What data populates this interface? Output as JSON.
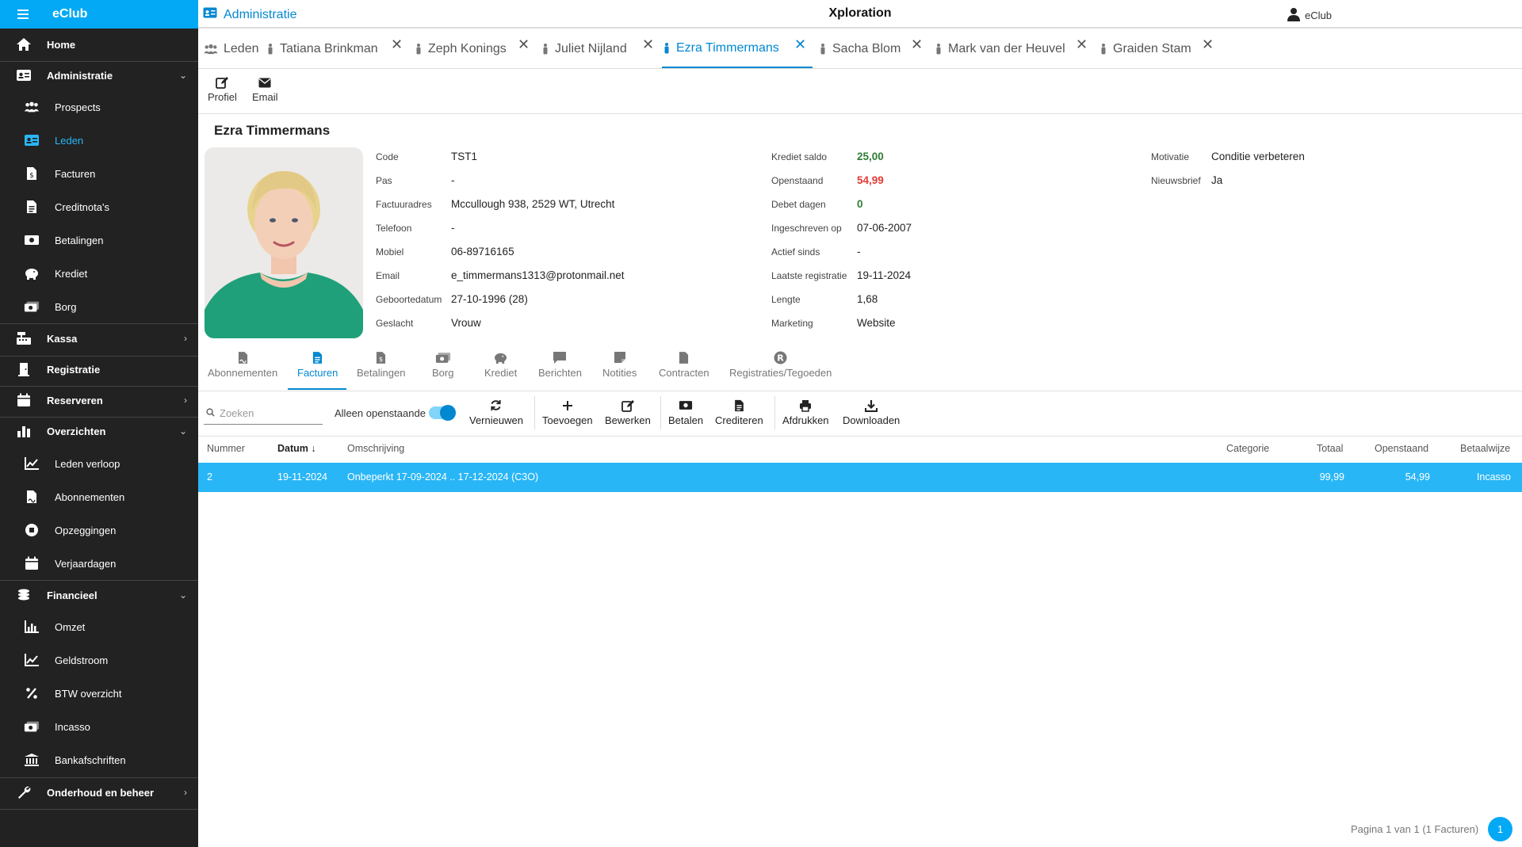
{
  "app": {
    "name": "eClub"
  },
  "topbar": {
    "module": "Administratie",
    "center_title": "Xploration",
    "user": "eClub"
  },
  "sidebar": {
    "home": "Home",
    "administratie": "Administratie",
    "prospects": "Prospects",
    "leden": "Leden",
    "facturen": "Facturen",
    "creditnotas": "Creditnota's",
    "betalingen": "Betalingen",
    "krediet": "Krediet",
    "borg": "Borg",
    "kassa": "Kassa",
    "registratie": "Registratie",
    "reserveren": "Reserveren",
    "overzichten": "Overzichten",
    "leden_verloop": "Leden verloop",
    "abonnementen": "Abonnementen",
    "opzeggingen": "Opzeggingen",
    "verjaardagen": "Verjaardagen",
    "financieel": "Financieel",
    "omzet": "Omzet",
    "geldstroom": "Geldstroom",
    "btw": "BTW overzicht",
    "incasso": "Incasso",
    "bankafschriften": "Bankafschriften",
    "onderhoud": "Onderhoud en beheer"
  },
  "tabs": {
    "leden": "Leden",
    "t1": "Tatiana Brinkman",
    "t2": "Zeph Konings",
    "t3": "Juliet Nijland",
    "t4": "Ezra Timmermans",
    "t5": "Sacha Blom",
    "t6": "Mark van der Heuvel",
    "t7": "Graiden Stam",
    "close": "✕"
  },
  "actions": {
    "profiel": "Profiel",
    "email": "Email"
  },
  "member": {
    "name": "Ezra Timmermans",
    "labels": {
      "code": "Code",
      "pas": "Pas",
      "factuuradres": "Factuuradres",
      "telefoon": "Telefoon",
      "mobiel": "Mobiel",
      "email": "Email",
      "geboortedatum": "Geboortedatum",
      "geslacht": "Geslacht",
      "krediet_saldo": "Krediet saldo",
      "openstaand": "Openstaand",
      "debet_dagen": "Debet dagen",
      "ingeschreven_op": "Ingeschreven op",
      "actief_sinds": "Actief sinds",
      "laatste_registratie": "Laatste registratie",
      "lengte": "Lengte",
      "marketing": "Marketing",
      "motivatie": "Motivatie",
      "nieuwsbrief": "Nieuwsbrief"
    },
    "values": {
      "code": "TST1",
      "pas": "-",
      "factuuradres": "Mccullough 938, 2529 WT, Utrecht",
      "telefoon": "-",
      "mobiel": "06-89716165",
      "email": "e_timmermans1313@protonmail.net",
      "geboortedatum": "27-10-1996 (28)",
      "geslacht": "Vrouw",
      "krediet_saldo": "25,00",
      "openstaand": "54,99",
      "debet_dagen": "0",
      "ingeschreven_op": "07-06-2007",
      "actief_sinds": "-",
      "laatste_registratie": "19-11-2024",
      "lengte": "1,68",
      "marketing": "Website",
      "motivatie": "Conditie verbeteren",
      "nieuwsbrief": "Ja"
    }
  },
  "subtabs": {
    "abonnementen": "Abonnementen",
    "facturen": "Facturen",
    "betalingen": "Betalingen",
    "borg": "Borg",
    "krediet": "Krediet",
    "berichten": "Berichten",
    "notities": "Notities",
    "contracten": "Contracten",
    "registraties": "Registraties/Tegoeden"
  },
  "grid_toolbar": {
    "search_placeholder": "Zoeken",
    "toggle_label": "Alleen openstaande",
    "toggle_on": true,
    "vernieuwen": "Vernieuwen",
    "toevoegen": "Toevoegen",
    "bewerken": "Bewerken",
    "betalen": "Betalen",
    "crediteren": "Crediteren",
    "afdrukken": "Afdrukken",
    "downloaden": "Downloaden"
  },
  "table": {
    "headers": {
      "nummer": "Nummer",
      "datum": "Datum",
      "sort": "↓",
      "omschrijving": "Omschrijving",
      "categorie": "Categorie",
      "totaal": "Totaal",
      "openstaand": "Openstaand",
      "betaalwijze": "Betaalwijze"
    },
    "rows": [
      {
        "nummer": "2",
        "datum": "19-11-2024",
        "omschrijving": "Onbeperkt 17-09-2024 .. 17-12-2024 (C3O)",
        "categorie": "",
        "totaal": "99,99",
        "openstaand": "54,99",
        "betaalwijze": "Incasso"
      }
    ]
  },
  "pager": {
    "text": "Pagina 1 van 1 (1 Facturen)",
    "current": "1"
  },
  "colors": {
    "accent": "#03a9f4",
    "accent_dark": "#0288d1",
    "sidebar_bg": "#222222",
    "positive": "#2e7d32",
    "negative": "#e53935"
  }
}
